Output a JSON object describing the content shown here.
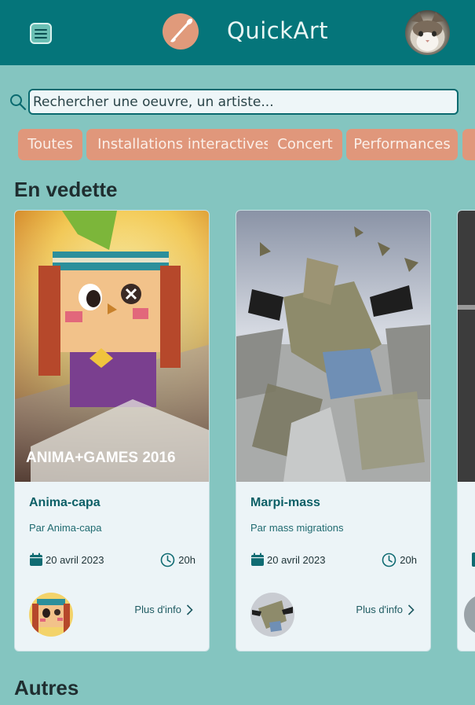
{
  "header": {
    "title": "QuickArt",
    "menu_icon": "hamburger-menu-icon",
    "logo_icon": "paintbrush-icon",
    "avatar": "user-avatar-cat"
  },
  "search": {
    "placeholder": "Rechercher une oeuvre, un artiste...",
    "icon": "search-icon"
  },
  "categories": [
    {
      "label": "Toutes"
    },
    {
      "label": "Installations interactives"
    },
    {
      "label": "Concert"
    },
    {
      "label": "Performances"
    }
  ],
  "sections": {
    "featured_title": "En vedette",
    "others_title": "Autres"
  },
  "cards": [
    {
      "image_caption": "ANIMA+GAMES 2016",
      "title": "Anima-capa",
      "author": "Par Anima-capa",
      "date": "20 avril 2023",
      "time": "20h",
      "more": "Plus d'info"
    },
    {
      "title": "Marpi-mass",
      "author": "Par mass migrations",
      "date": "20 avril 2023",
      "time": "20h",
      "more": "Plus d'info"
    }
  ],
  "colors": {
    "background": "#84c5c0",
    "header": "#05757a",
    "chip": "#e0977b",
    "card": "#ecf4f7",
    "card_title": "#0c5f66"
  }
}
